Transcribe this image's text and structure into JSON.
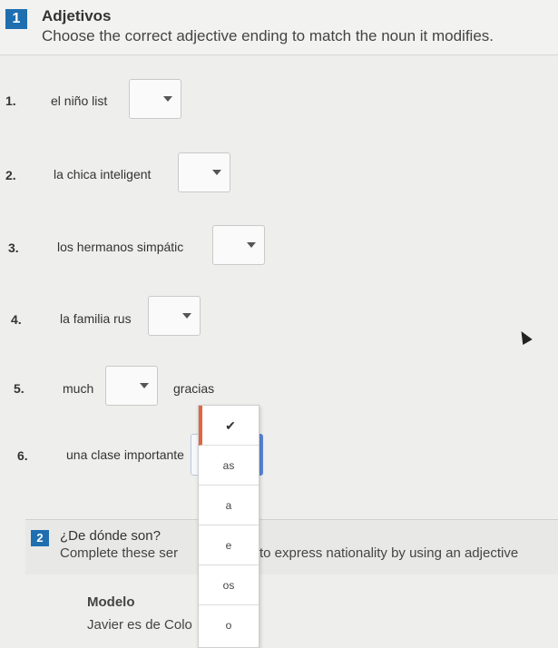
{
  "section1": {
    "number": "1",
    "title": "Adjetivos",
    "subtitle": "Choose the correct adjective ending to match the noun it modifies."
  },
  "questions": [
    {
      "num": "1.",
      "before": "el niño list",
      "after": ""
    },
    {
      "num": "2.",
      "before": "la chica inteligent",
      "after": ""
    },
    {
      "num": "3.",
      "before": "los hermanos simpátic",
      "after": ""
    },
    {
      "num": "4.",
      "before": "la familia rus",
      "after": ""
    },
    {
      "num": "5.",
      "before": "much",
      "after": "gracias"
    },
    {
      "num": "6.",
      "before": "una clase importante",
      "after": ""
    }
  ],
  "dropdown_options": [
    "✔",
    "as",
    "a",
    "e",
    "os",
    "o"
  ],
  "section2": {
    "number": "2",
    "title": "¿De dónde son?",
    "subtitle_left": "Complete these ser",
    "subtitle_right": "to express nationality by using an adjective"
  },
  "modelo": {
    "label": "Modelo",
    "text": "Javier es de Colo"
  }
}
